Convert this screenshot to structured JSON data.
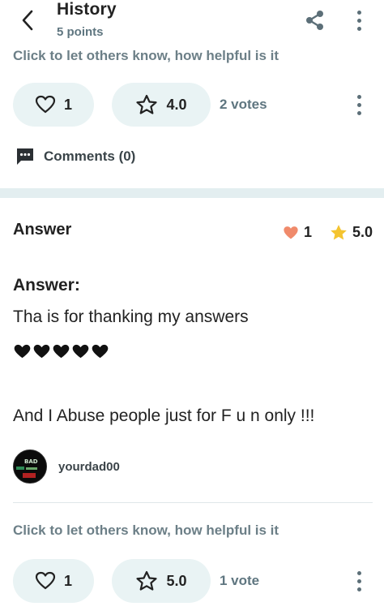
{
  "header": {
    "title": "History",
    "subtitle": "5 points",
    "icons": {
      "back": "back-arrow-icon",
      "share": "share-icon",
      "more": "more-vertical-icon"
    }
  },
  "first_answer": {
    "helpful_prompt": "Click to let others know, how helpful is it",
    "thanks_count": "1",
    "rating": "4.0",
    "votes": "2 votes",
    "comments_label": "Comments (0)"
  },
  "second_answer": {
    "section_title": "Answer",
    "thanks_count": "1",
    "rating": "5.0",
    "answer_label": "Answer:",
    "line1": "Tha is for thanking my answers",
    "heart_count": 5,
    "line2": "And I Abuse people just for F u n only !!!",
    "author": "yourdad00",
    "avatar_text": "BAD",
    "helpful_prompt": "Click to let others know, how helpful is it",
    "vote_thanks_count": "1",
    "vote_rating": "5.0",
    "votes": "1 vote"
  },
  "colors": {
    "accent_bg": "#e9f3f4",
    "muted_text": "#6c7f87",
    "heart": "#f08a6b",
    "star": "#f4c430"
  }
}
